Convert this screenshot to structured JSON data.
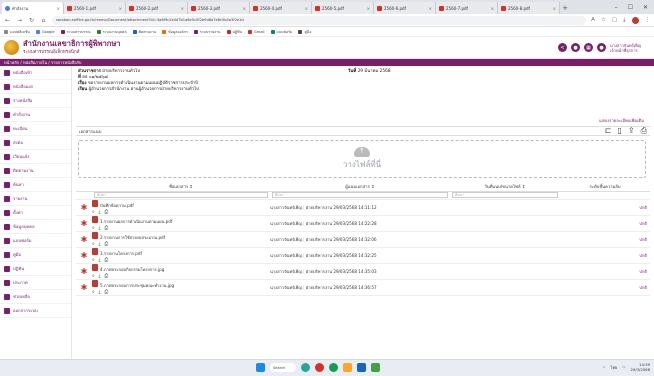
{
  "browser": {
    "tabs": [
      {
        "label": "คำสั่งงาน",
        "active": true
      },
      {
        "label": "2560-1.pdf",
        "active": false
      },
      {
        "label": "2560-2.pdf",
        "active": false
      },
      {
        "label": "2560-3.pdf",
        "active": false
      },
      {
        "label": "2560-4.pdf",
        "active": false
      },
      {
        "label": "2560-5.pdf",
        "active": false
      },
      {
        "label": "2560-6.pdf",
        "active": false
      },
      {
        "label": "2560-7.pdf",
        "active": false
      },
      {
        "label": "2560-8.pdf",
        "active": false
      }
    ],
    "url": "saraban.eoffice.go.th/memo/Document/attachment?id=3a8f9c2e4d7b1a6e5c0f2b9d8a7e6c5b4a3f2e1d",
    "bookmarks": [
      "แอปพลิเคชัน",
      "Google",
      "ระบบสารบรรณ",
      "ระบบงานบุคคล",
      "ติดตามงาน",
      "ข้อมูลองค์กร",
      "ระบบรายงาน",
      "ปฏิทิน",
      "Gmail",
      "แบบฟอร์ม",
      "คู่มือ"
    ]
  },
  "header": {
    "org_name": "สำนักงานเลขาธิการผู้พิพากษา",
    "org_sub": "ระบบสารบรรณอิเล็กทรอนิกส์",
    "user_line1": "นางสาวจันทร์เพ็ญ",
    "user_line2": "เจ้าหน้าที่ธุรการ"
  },
  "breadcrumb": "หน้าหลัก / หนังสือภายใน / รายการหนังสือรับ",
  "sidebar": {
    "items": [
      {
        "label": "หนังสือเข้า"
      },
      {
        "label": "หนังสือออก"
      },
      {
        "label": "ร่างหนังสือ"
      },
      {
        "label": "คำสั่งงาน"
      },
      {
        "label": "ทะเบียน"
      },
      {
        "label": "ส่งต่อ"
      },
      {
        "label": "เวียนแจ้ง"
      },
      {
        "label": "ติดตามงาน"
      },
      {
        "label": "ค้นหา"
      },
      {
        "label": "รายงาน"
      },
      {
        "label": "ตั้งค่า"
      },
      {
        "label": "ข้อมูลบุคคล"
      },
      {
        "label": "แบบฟอร์ม"
      },
      {
        "label": "คู่มือ"
      },
      {
        "label": "ปฏิทิน"
      },
      {
        "label": "ประกาศ"
      },
      {
        "label": "ช่วยเหลือ"
      },
      {
        "label": "ออกจากระบบ"
      }
    ]
  },
  "document": {
    "from_label": "ส่วนราชการ",
    "from_value": "ฝ่ายบริหารงานทั่วไป",
    "date_label": "วันที่",
    "date_value": "29 มีนาคม 2568",
    "doc_no_label": "ที่",
    "doc_no_value": "ตธ ๐๑/๒๕๖๘",
    "subject_label": "เรื่อง",
    "subject_value": "ขอรายงานผลการดำเนินงานตามแผนปฏิบัติราชการประจำปี",
    "to_label": "เรียน",
    "to_value": "ผู้อำนวยการสำนักงาน ผ่านผู้อำนวยการฝ่ายบริหารงานทั่วไป",
    "attach_link": "แสดงรายละเอียดเพิ่มเติม"
  },
  "attachments": {
    "title": "เอกสารแนบ",
    "drop_text": "วางไฟล์ที่นี่",
    "headers": {
      "name": "ชื่อเอกสาร ⇕",
      "uploader": "ผู้แนบเอกสาร ⇕",
      "date": "วันที่แนบ/ขนาดไฟล์ ⇕",
      "status": "ระดับชั้นความลับ"
    },
    "filter_placeholder": "ค้นหา",
    "rows": [
      {
        "name": "บันทึกข้อความ.pdf",
        "uploader": "นางสาวจันทร์เพ็ญ : ฝ่ายบริหารงาน 29/03/2568 14:11:12",
        "status": "ปกติ"
      },
      {
        "name": "1.รายงานผลการดำเนินงานตามแผน.pdf",
        "uploader": "นางสาวจันทร์เพ็ญ : ฝ่ายบริหารงาน 29/03/2568 14:22:28",
        "status": "ปกติ"
      },
      {
        "name": "2.รายงานการใช้จ่ายงบประมาณ.pdf",
        "uploader": "นางสาวจันทร์เพ็ญ : ฝ่ายบริหารงาน 29/03/2568 14:32:06",
        "status": "ปกติ"
      },
      {
        "name": "3.รายงานโครงการ.pdf",
        "uploader": "นางสาวจันทร์เพ็ญ : ฝ่ายบริหารงาน 29/03/2568 14:32:25",
        "status": "ปกติ"
      },
      {
        "name": "4.ภาพประกอบกิจกรรมโครงการ.jpg",
        "uploader": "นางสาวจันทร์เพ็ญ : ฝ่ายบริหารงาน 29/03/2568 14:35:03",
        "status": "ปกติ"
      },
      {
        "name": "5.ภาพประกอบการประชุมคณะทำงาน.jpg",
        "uploader": "นางสาวจันทร์เพ็ญ : ฝ่ายบริหารงาน 29/03/2568 14:36:57",
        "status": "ปกติ"
      }
    ]
  },
  "taskbar": {
    "search": "Search",
    "time": "14:39",
    "date": "29/3/2568",
    "lang": "ไทย"
  }
}
